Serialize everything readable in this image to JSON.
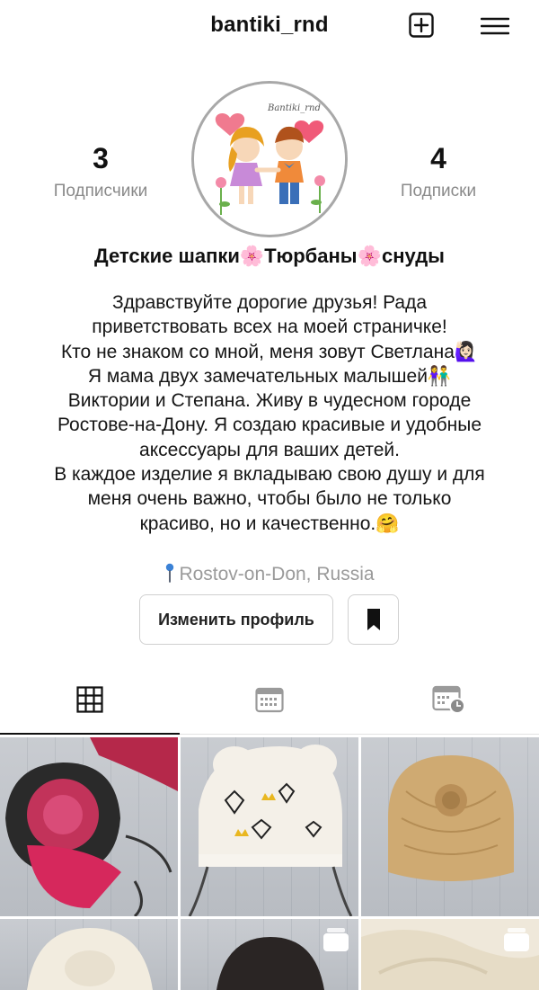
{
  "header": {
    "username": "bantiki_rnd",
    "new_post_icon": "plus-square-icon",
    "menu_icon": "hamburger-menu-icon"
  },
  "profile": {
    "avatar_logo_text": "Bantiki_rnd",
    "followers_count": "3",
    "followers_label": "Подписчики",
    "following_count": "4",
    "following_label": "Подписки",
    "full_name": "Детские шапки🌸Тюрбаны🌸снуды",
    "bio_lines": [
      "Здравствуйте дорогие друзья! Рада",
      "приветствовать всех на моей страничке!",
      "Кто не знаком со мной, меня зовут Светлана🙋🏻‍♀️",
      "Я мама двух замечательных малышей👫",
      "Виктории и Степана. Живу в чудесном городе",
      "Ростове-на-Дону. Я создаю красивые и удобные",
      "аксессуары для ваших детей.",
      "В каждое изделие я вкладываю свою душу и для",
      "меня очень важно, чтобы было не только",
      "красиво, но и качественно.🤗"
    ],
    "location": "Rostov-on-Don, Russia"
  },
  "actions": {
    "edit_profile_label": "Изменить профиль",
    "saved_icon": "bookmark-icon"
  },
  "tabs": [
    {
      "name": "grid",
      "icon": "grid-icon",
      "active": true
    },
    {
      "name": "calendar",
      "icon": "calendar-icon",
      "active": false
    },
    {
      "name": "scheduled",
      "icon": "calendar-clock-icon",
      "active": false
    }
  ],
  "colors": {
    "text": "#111111",
    "muted": "#8a8a8a",
    "border": "#d0d0d0",
    "pin": "#3b82d6"
  },
  "posts": [
    {
      "desc": "pink floral turban with headband",
      "multi": false
    },
    {
      "desc": "white hat with crowns and diamonds print",
      "multi": false
    },
    {
      "desc": "beige ribbed turban",
      "multi": false
    },
    {
      "desc": "cream turban",
      "multi": false
    },
    {
      "desc": "dark hat",
      "multi": true
    },
    {
      "desc": "cream knit",
      "multi": true
    }
  ]
}
